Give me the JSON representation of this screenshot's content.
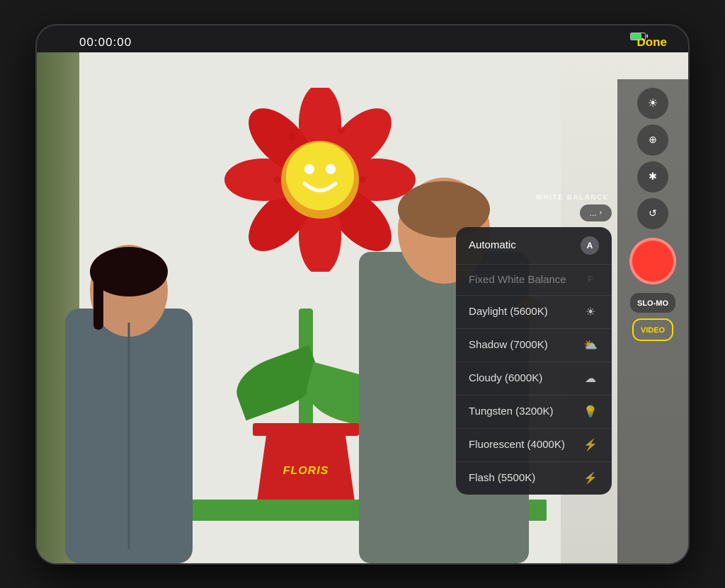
{
  "statusBar": {
    "timer": "00:00:00",
    "doneLabel": "Done"
  },
  "whiteBalance": {
    "sectionLabel": "WHITE BALANCE",
    "headerBtn": "...",
    "items": [
      {
        "id": "automatic",
        "label": "Automatic",
        "icon": "Ⓐ",
        "state": "selected"
      },
      {
        "id": "fixed",
        "label": "Fixed White Balance",
        "icon": "Ⓕ",
        "state": "dimmed"
      },
      {
        "id": "daylight",
        "label": "Daylight (5600K)",
        "icon": "☀",
        "state": "normal"
      },
      {
        "id": "shadow",
        "label": "Shadow (7000K)",
        "icon": "⛅",
        "state": "normal"
      },
      {
        "id": "cloudy",
        "label": "Cloudy (6000K)",
        "icon": "☁",
        "state": "normal"
      },
      {
        "id": "tungsten",
        "label": "Tungsten (3200K)",
        "icon": "💡",
        "state": "normal"
      },
      {
        "id": "fluorescent",
        "label": "Fluorescent (4000K)",
        "icon": "⚡",
        "state": "normal"
      },
      {
        "id": "flash",
        "label": "Flash (5500K)",
        "icon": "⚡",
        "state": "normal"
      }
    ]
  },
  "rightPanel": {
    "controls": [
      {
        "id": "wb-control",
        "icon": "☀",
        "label": "white-balance"
      },
      {
        "id": "ev-control",
        "icon": "⊕",
        "label": "exposure"
      },
      {
        "id": "flash-control",
        "icon": "✱",
        "label": "flash"
      },
      {
        "id": "live-control",
        "icon": "↺",
        "label": "live-photo"
      }
    ],
    "sloMoLabel": "SLO-MO",
    "videoLabel": "VIDEO"
  },
  "scene": {
    "potText": "FLORIS"
  },
  "colors": {
    "accent": "#FFD700",
    "record": "#ff3b30",
    "bg": "#1c1c1e"
  }
}
